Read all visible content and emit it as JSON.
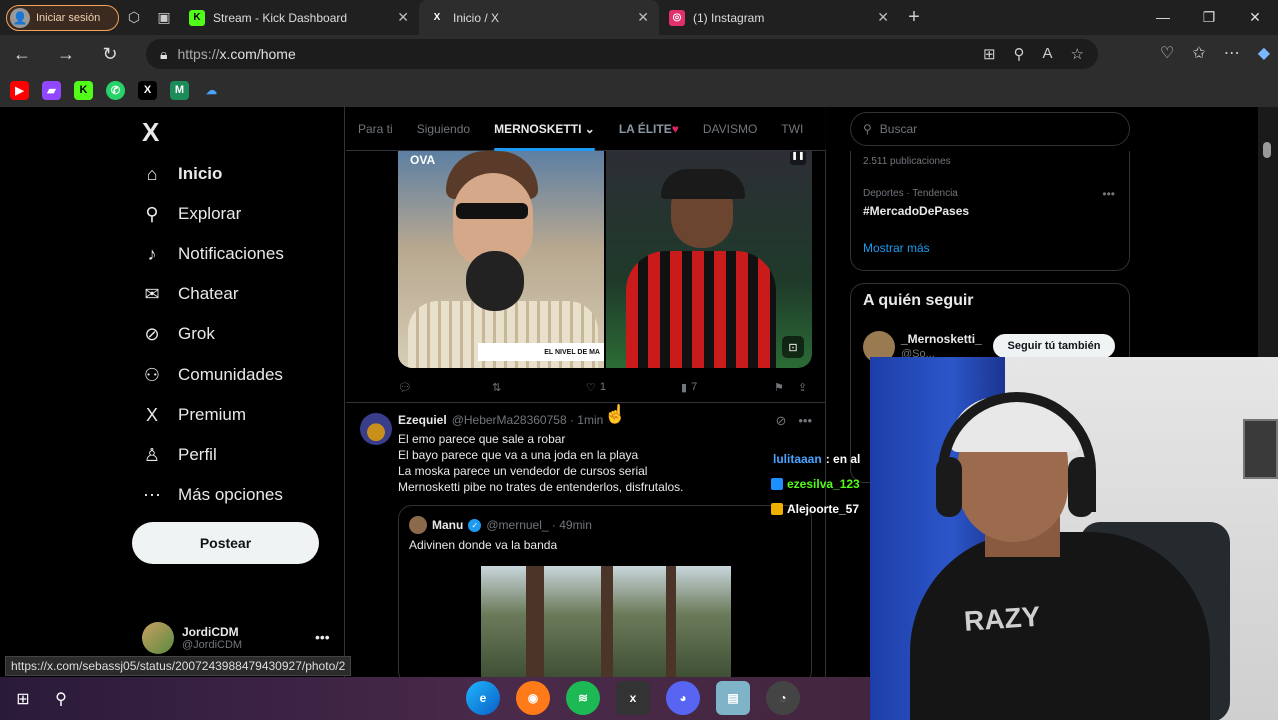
{
  "browser": {
    "profile_label": "Iniciar sesión",
    "tabs": [
      {
        "title": "Stream - Kick Dashboard",
        "favicon": "K",
        "color": "#53fc18"
      },
      {
        "title": "Inicio / X",
        "favicon": "X",
        "color": "#ffffff"
      },
      {
        "title": "(1) Instagram",
        "favicon": "◎",
        "color": "#e1306c"
      }
    ],
    "url_host": "https://",
    "url_path": "x.com/home",
    "bookmarks": [
      "youtube-icon",
      "twitch-icon",
      "kick-icon",
      "whatsapp-icon",
      "x-icon",
      "mega-icon",
      "cloud-icon"
    ]
  },
  "sidebar": {
    "items": [
      {
        "label": "Inicio",
        "icon": "home-icon",
        "glyph": "⌂"
      },
      {
        "label": "Explorar",
        "icon": "search-icon",
        "glyph": "⚲"
      },
      {
        "label": "Notificaciones",
        "icon": "bell-icon",
        "glyph": "♪"
      },
      {
        "label": "Chatear",
        "icon": "mail-icon",
        "glyph": "✉"
      },
      {
        "label": "Grok",
        "icon": "grok-icon",
        "glyph": "⊘"
      },
      {
        "label": "Comunidades",
        "icon": "people-icon",
        "glyph": "⚇"
      },
      {
        "label": "Premium",
        "icon": "x-premium-icon",
        "glyph": "X"
      },
      {
        "label": "Perfil",
        "icon": "person-icon",
        "glyph": "♙"
      },
      {
        "label": "Más opciones",
        "icon": "more-circle-icon",
        "glyph": "⋯"
      }
    ],
    "post_label": "Postear",
    "account": {
      "name": "JordiCDM",
      "handle": "@JordiCDM"
    }
  },
  "status_url": "https://x.com/sebassj05/status/2007243988479430927/photo/2",
  "timeline": {
    "tabs": [
      "Para ti",
      "Siguiendo",
      "MERNOSKETTI",
      "LA ÉLITE",
      "DAVISMO",
      "TWI"
    ],
    "media_tag": "OVA",
    "media_caption": "EL NIVEL DE MA",
    "actions": {
      "likes": "1",
      "views": "7"
    },
    "tweet": {
      "name": "Ezequiel",
      "handle": "@HeberMa28360758 · 1min",
      "lines": [
        "El emo parece que sale a robar",
        "El bayo parece que va a una joda en la playa",
        "La moska parece un vendedor de cursos serial",
        "Mernosketti pibe no trates de entenderlos, disfrutalos."
      ],
      "quote": {
        "name": "Manu",
        "handle": "@mernuel_ · 49min",
        "text": "Adivinen donde va la banda"
      }
    }
  },
  "right": {
    "search_placeholder": "Buscar",
    "posts_count": "2.511 publicaciones",
    "trend_category": "Deportes · Tendencia",
    "trend_name": "#MercadoDePases",
    "show_more": "Mostrar más",
    "follow_title": "A quién seguir",
    "follow_name": "_Mernosketti_",
    "follow_handle": "@So...",
    "follow_button": "Seguir tú también"
  },
  "chat": [
    {
      "user": "lulitaaan",
      "text": ": en al",
      "color": "#4aa3ff"
    },
    {
      "user": "ezesilva_123",
      "text": "",
      "color": "#53fc18"
    },
    {
      "user": "Alejoorte_57",
      "text": "",
      "color": "#ffffff"
    }
  ],
  "webcam": {
    "shirt_print": "RAZY"
  }
}
